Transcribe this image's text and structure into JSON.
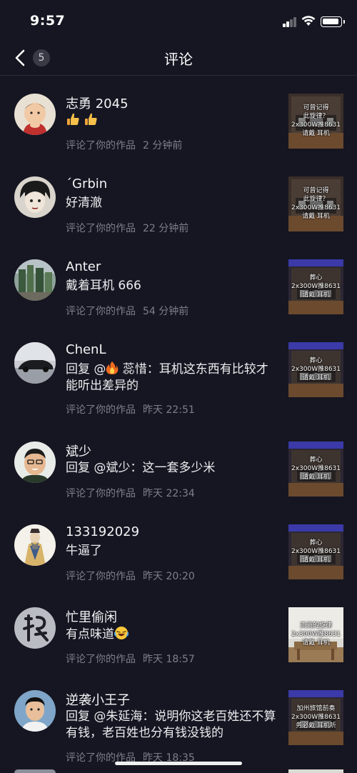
{
  "status_bar": {
    "time": "9:57"
  },
  "nav": {
    "title": "评论",
    "back_count": "5"
  },
  "items": [
    {
      "name": "志勇 2045",
      "content": "",
      "action": "评论了你的作品",
      "time": "2 分钟前",
      "thumb": [
        "可曾记得",
        "此旋律？",
        "2x300W推8631",
        "请戴   耳机"
      ]
    },
    {
      "name": "´Grbin",
      "content": "好清澈",
      "action": "评论了你的作品",
      "time": "22 分钟前",
      "thumb": [
        "可曾记得",
        "此旋律？",
        "2x300W推8631",
        "请戴   耳机"
      ]
    },
    {
      "name": "Anter",
      "content": "戴着耳机 666",
      "action": "评论了你的作品",
      "time": "54 分钟前",
      "thumb": [
        "葬心",
        "2x300W推8631",
        "请戴   耳机"
      ]
    },
    {
      "name": "ChenL",
      "content_prefix": "回复 @",
      "content_rest": " 蕊惜：耳机这东西有比较才能听出差异的",
      "action": "评论了你的作品",
      "time": "昨天 22:51",
      "thumb": [
        "葬心",
        "2x300W推8631",
        "请戴   耳机"
      ]
    },
    {
      "name": "斌少",
      "content": "回复 @斌少：这一套多少米",
      "action": "评论了你的作品",
      "time": "昨天 22:34",
      "thumb": [
        "葬心",
        "2x300W推8631",
        "请戴   耳机"
      ]
    },
    {
      "name": "133192029",
      "content": "牛逼了",
      "action": "评论了你的作品",
      "time": "昨天 20:20",
      "thumb": [
        "葬心",
        "2x300W推8631",
        "请戴   耳机"
      ]
    },
    {
      "name": "忙里偷闲",
      "content": "有点味道",
      "action": "评论了你的作品",
      "time": "昨天 18:57",
      "thumb": [
        "流淌的旋律",
        "2x300W推8631",
        "请戴   耳机"
      ]
    },
    {
      "name": "逆袭小王子",
      "content": "回复 @朱延海：说明你这老百姓还不算有钱，老百姓也分有钱没钱的",
      "action": "评论了你的作品",
      "time": "昨天 18:35",
      "thumb": [
        "加州旅馆前奏",
        "2x300W推8631",
        "务必戴   耳机听"
      ]
    }
  ]
}
